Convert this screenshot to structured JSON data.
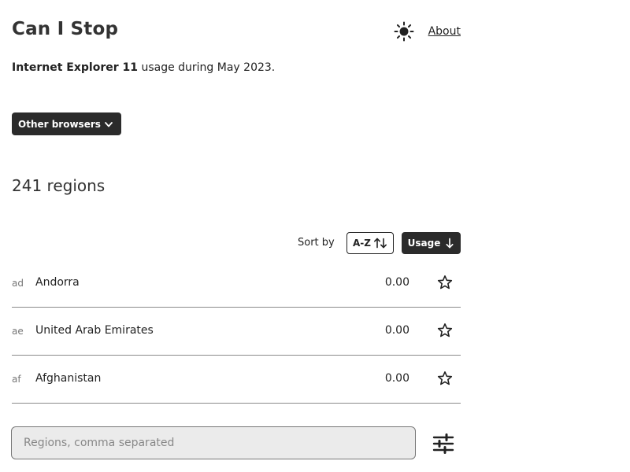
{
  "header": {
    "title": "Can I Stop",
    "about_label": "About",
    "theme_icon": "sun-icon"
  },
  "summary": {
    "browser": "Internet Explorer 11",
    "period_text": "usage during May 2023."
  },
  "browser_menu": {
    "label": "Other browsers",
    "icon": "chevron-down-icon"
  },
  "regions": {
    "count_label": "241 regions"
  },
  "sort": {
    "label": "Sort by",
    "az_label": "A-Z",
    "az_icon": "swap-vertical-icon",
    "usage_label": "Usage",
    "usage_icon": "arrow-down-icon",
    "active": "Usage"
  },
  "rows": [
    {
      "code": "ad",
      "name": "Andorra",
      "usage": "0.00"
    },
    {
      "code": "ae",
      "name": "United Arab Emirates",
      "usage": "0.00"
    },
    {
      "code": "af",
      "name": "Afghanistan",
      "usage": "0.00"
    }
  ],
  "filter": {
    "placeholder": "Regions, comma separated",
    "value": "",
    "filter_icon": "sliders-icon"
  },
  "colors": {
    "dark_button": "#2b2b2b",
    "text": "#222222",
    "input_bg": "#ebebeb",
    "divider": "#8a8a8a"
  }
}
